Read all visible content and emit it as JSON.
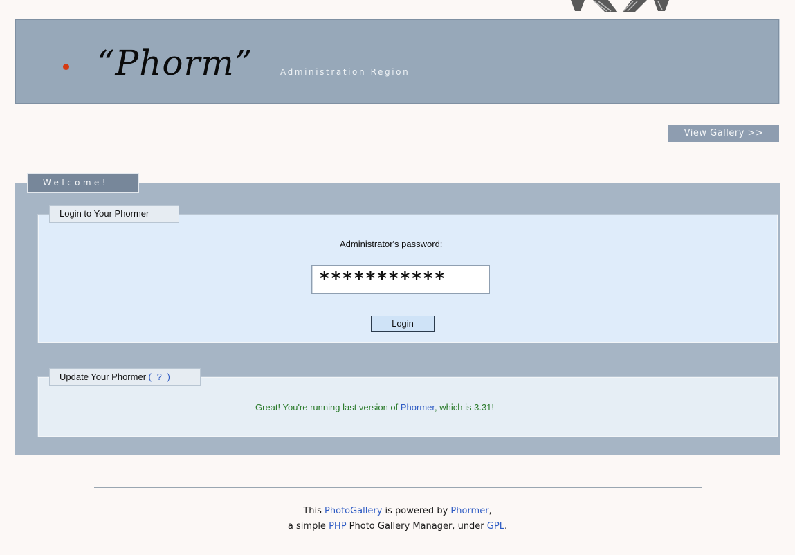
{
  "header": {
    "logo_text": "“Phorm”",
    "subtitle": "Administration Region",
    "accent_color": "#d53a12"
  },
  "nav": {
    "view_gallery_label": "View Gallery >>"
  },
  "welcome": {
    "tab_label": "Welcome!",
    "login_section": {
      "legend": "Login to Your Phormer",
      "password_label": "Administrator's password:",
      "password_value": "***********",
      "login_button": "Login"
    },
    "update_section": {
      "legend": "Update Your Phormer",
      "help_label": "( ? )",
      "message_prefix": "Great! You're running last version of ",
      "message_link": "Phormer",
      "message_suffix": ", which is 3.31!"
    }
  },
  "footer": {
    "line1_prefix": "This ",
    "line1_link1": "PhotoGallery",
    "line1_mid": " is powered by ",
    "line1_link2": "Phormer",
    "line1_suffix": ",",
    "line2_prefix": "a simple ",
    "line2_link1": "PHP",
    "line2_mid": " Photo Gallery Manager, under ",
    "line2_link2": "GPL",
    "line2_suffix": "."
  }
}
